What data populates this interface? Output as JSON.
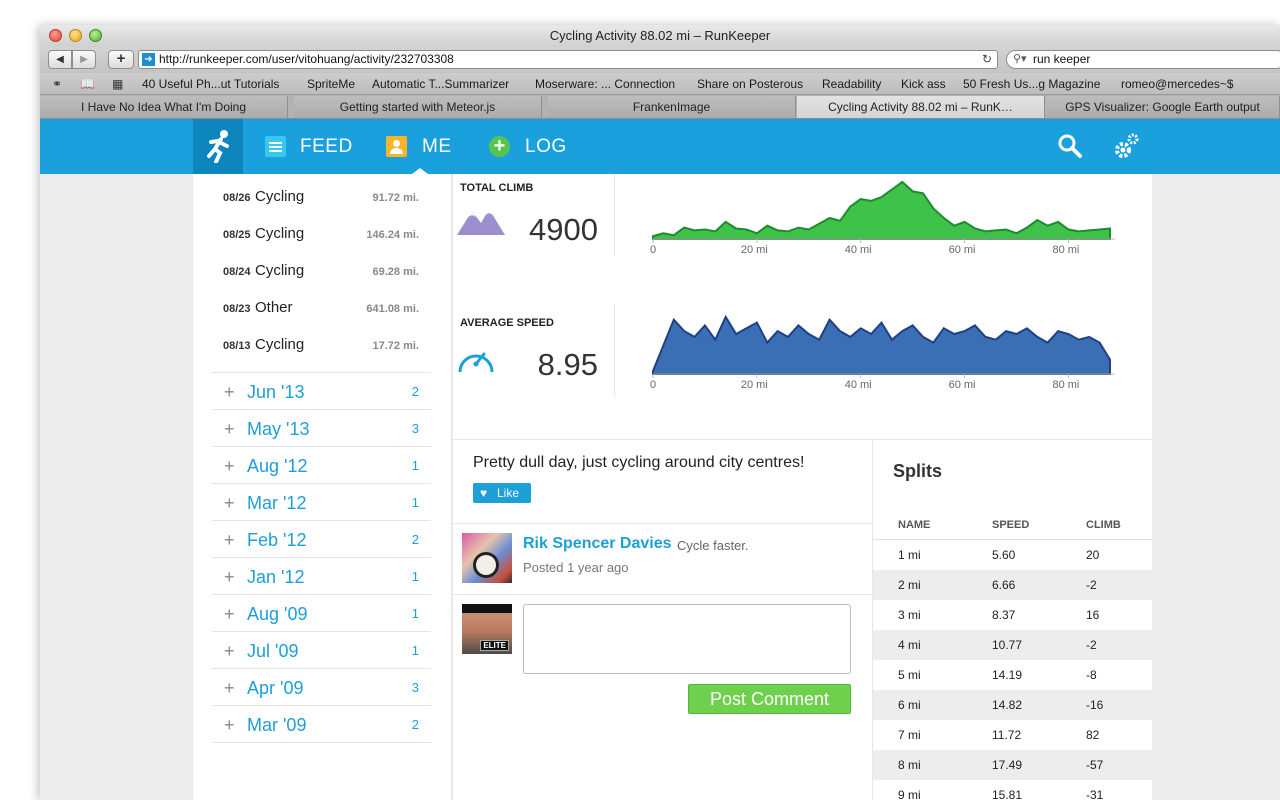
{
  "window": {
    "title": "Cycling Activity 88.02 mi – RunKeeper"
  },
  "toolbar": {
    "back_label": "◀",
    "forward_label": "▶",
    "add_label": "+",
    "url": "http://runkeeper.com/user/vitohuang/activity/232703308",
    "search_value": "run keeper"
  },
  "bookmarks": [
    "40 Useful Ph...ut Tutorials",
    "SpriteMe",
    "Automatic T...Summarizer",
    "Moserware: ... Connection",
    "Share on Posterous",
    "Readability",
    "Kick ass",
    "50 Fresh Us...g Magazine",
    "romeo@mercedes~$"
  ],
  "tabs": [
    {
      "label": "I Have No Idea What I'm Doing",
      "active": false
    },
    {
      "label": "Getting started with Meteor.js",
      "active": false
    },
    {
      "label": "FrankenImage",
      "active": false
    },
    {
      "label": "Cycling Activity 88.02 mi – RunK…",
      "active": true
    },
    {
      "label": "GPS Visualizer: Google Earth output",
      "active": false
    }
  ],
  "nav": {
    "feed": "FEED",
    "me": "ME",
    "log": "LOG",
    "brand_color": "#1aa0dc"
  },
  "activities": [
    {
      "date": "08/26",
      "type": "Cycling",
      "distance": "91.72 mi."
    },
    {
      "date": "08/25",
      "type": "Cycling",
      "distance": "146.24 mi."
    },
    {
      "date": "08/24",
      "type": "Cycling",
      "distance": "69.28 mi."
    },
    {
      "date": "08/23",
      "type": "Other",
      "distance": "641.08 mi."
    },
    {
      "date": "08/13",
      "type": "Cycling",
      "distance": "17.72 mi."
    }
  ],
  "months": [
    {
      "name": "Jun '13",
      "count": "2"
    },
    {
      "name": "May '13",
      "count": "3"
    },
    {
      "name": "Aug '12",
      "count": "1"
    },
    {
      "name": "Mar '12",
      "count": "1"
    },
    {
      "name": "Feb '12",
      "count": "2"
    },
    {
      "name": "Jan '12",
      "count": "1"
    },
    {
      "name": "Aug '09",
      "count": "1"
    },
    {
      "name": "Jul '09",
      "count": "1"
    },
    {
      "name": "Apr '09",
      "count": "3"
    },
    {
      "name": "Mar '09",
      "count": "2"
    }
  ],
  "stats": {
    "climb_label": "TOTAL CLIMB",
    "climb_value": "4900",
    "speed_label": "AVERAGE SPEED",
    "speed_value": "8.95"
  },
  "chart_data": [
    {
      "type": "area",
      "series": [
        {
          "color": "#3ec24a"
        }
      ],
      "x_ticks": [
        "0",
        "20 mi",
        "40 mi",
        "60 mi",
        "80 mi"
      ],
      "xlim": [
        0,
        88
      ],
      "x": [
        0,
        2,
        4,
        6,
        8,
        10,
        12,
        14,
        16,
        18,
        20,
        22,
        24,
        26,
        28,
        30,
        32,
        34,
        36,
        38,
        40,
        42,
        44,
        46,
        48,
        50,
        52,
        54,
        56,
        58,
        60,
        62,
        64,
        66,
        68,
        70,
        72,
        74,
        76,
        78,
        80,
        82,
        84,
        86,
        88
      ],
      "y": [
        3,
        6,
        4,
        12,
        9,
        10,
        8,
        18,
        11,
        10,
        6,
        14,
        9,
        8,
        12,
        10,
        16,
        22,
        19,
        34,
        42,
        40,
        44,
        52,
        60,
        50,
        48,
        32,
        22,
        14,
        18,
        11,
        8,
        9,
        10,
        6,
        12,
        20,
        14,
        18,
        10,
        8,
        9,
        10,
        11
      ]
    },
    {
      "type": "area",
      "series": [
        {
          "color": "#3a6fb5"
        }
      ],
      "x_ticks": [
        "0",
        "20 mi",
        "40 mi",
        "60 mi",
        "80 mi"
      ],
      "xlim": [
        0,
        88
      ],
      "x": [
        0,
        2,
        4,
        6,
        8,
        10,
        12,
        14,
        16,
        18,
        20,
        22,
        24,
        26,
        28,
        30,
        32,
        34,
        36,
        38,
        40,
        42,
        44,
        46,
        48,
        50,
        52,
        54,
        56,
        58,
        60,
        62,
        64,
        66,
        68,
        70,
        72,
        74,
        76,
        78,
        80,
        82,
        84,
        86,
        88
      ],
      "y": [
        2,
        20,
        38,
        30,
        26,
        34,
        24,
        40,
        28,
        32,
        36,
        22,
        30,
        26,
        34,
        28,
        24,
        38,
        30,
        26,
        32,
        28,
        36,
        24,
        30,
        34,
        26,
        22,
        32,
        28,
        30,
        34,
        26,
        24,
        30,
        28,
        32,
        26,
        22,
        30,
        28,
        24,
        26,
        22,
        10
      ]
    }
  ],
  "note": {
    "text": "Pretty dull day, just cycling around city centres!",
    "like_label": "Like"
  },
  "comment": {
    "author": "Rik Spencer Davies",
    "text": "Cycle faster.",
    "time": "Posted 1 year ago",
    "badge": "ELITE",
    "textarea_value": "",
    "post_label": "Post Comment"
  },
  "splits": {
    "title": "Splits",
    "headers": [
      "NAME",
      "SPEED",
      "CLIMB"
    ],
    "rows": [
      [
        "1 mi",
        "5.60",
        "20"
      ],
      [
        "2 mi",
        "6.66",
        "-2"
      ],
      [
        "3 mi",
        "8.37",
        "16"
      ],
      [
        "4 mi",
        "10.77",
        "-2"
      ],
      [
        "5 mi",
        "14.19",
        "-8"
      ],
      [
        "6 mi",
        "14.82",
        "-16"
      ],
      [
        "7 mi",
        "11.72",
        "82"
      ],
      [
        "8 mi",
        "17.49",
        "-57"
      ],
      [
        "9 mi",
        "15.81",
        "-31"
      ]
    ]
  }
}
